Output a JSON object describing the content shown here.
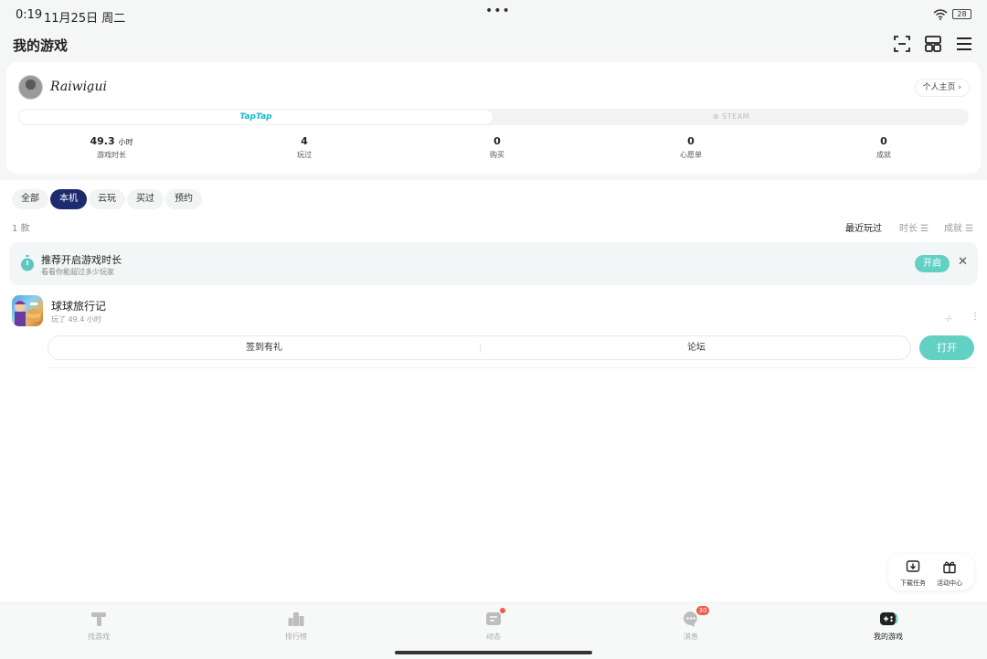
{
  "status_bar": {
    "time": "0:19",
    "date": "11月25日 周二",
    "dots": "•••",
    "battery": "28"
  },
  "header": {
    "title": "我的游戏",
    "icons": [
      "scan-icon",
      "grid-icon",
      "menu-icon"
    ]
  },
  "profile": {
    "username": "Raiwia̱ui",
    "home_link": "个人主页 ›",
    "platforms": {
      "taptap": "TapTap",
      "steam": "STEAM"
    },
    "stats": [
      {
        "value": "49.3",
        "unit": "小时",
        "label": "游戏时长"
      },
      {
        "value": "4",
        "unit": "",
        "label": "玩过"
      },
      {
        "value": "0",
        "unit": "",
        "label": "购买"
      },
      {
        "value": "0",
        "unit": "",
        "label": "心愿单"
      },
      {
        "value": "0",
        "unit": "",
        "label": "成就"
      }
    ]
  },
  "filters": [
    "全部",
    "本机",
    "云玩",
    "买过",
    "预约"
  ],
  "active_filter": "本机",
  "list": {
    "count": "1 款",
    "sorts": [
      "最近玩过",
      "时长 ☰",
      "成就 ☰"
    ]
  },
  "banner": {
    "title": "推荐开启游戏时长",
    "subtitle": "看看你能超过多少玩家",
    "button": "开启",
    "close": "✕"
  },
  "game": {
    "title": "球球旅行记",
    "playtime": "玩了 49.4 小时",
    "score": "-/-",
    "more": "⋮",
    "actions": [
      "签到有礼",
      "论坛"
    ],
    "open_button": "打开"
  },
  "float_panel": {
    "items": [
      {
        "label": "下载任务",
        "icon": "download-icon"
      },
      {
        "label": "活动中心",
        "icon": "gift-icon"
      }
    ]
  },
  "bottom_nav": {
    "items": [
      {
        "label": "找游戏",
        "icon": "discover-icon"
      },
      {
        "label": "排行榜",
        "icon": "ranking-icon"
      },
      {
        "label": "动态",
        "icon": "feed-icon"
      },
      {
        "label": "消息",
        "icon": "message-icon",
        "badge": "30"
      },
      {
        "label": "我的游戏",
        "icon": "gamepad-icon"
      }
    ],
    "active": "我的游戏"
  },
  "colors": {
    "accent": "#63d0c4",
    "active_filter": "#1e2a6e",
    "taptap": "#14b9c8",
    "badge": "#f05a4a"
  }
}
